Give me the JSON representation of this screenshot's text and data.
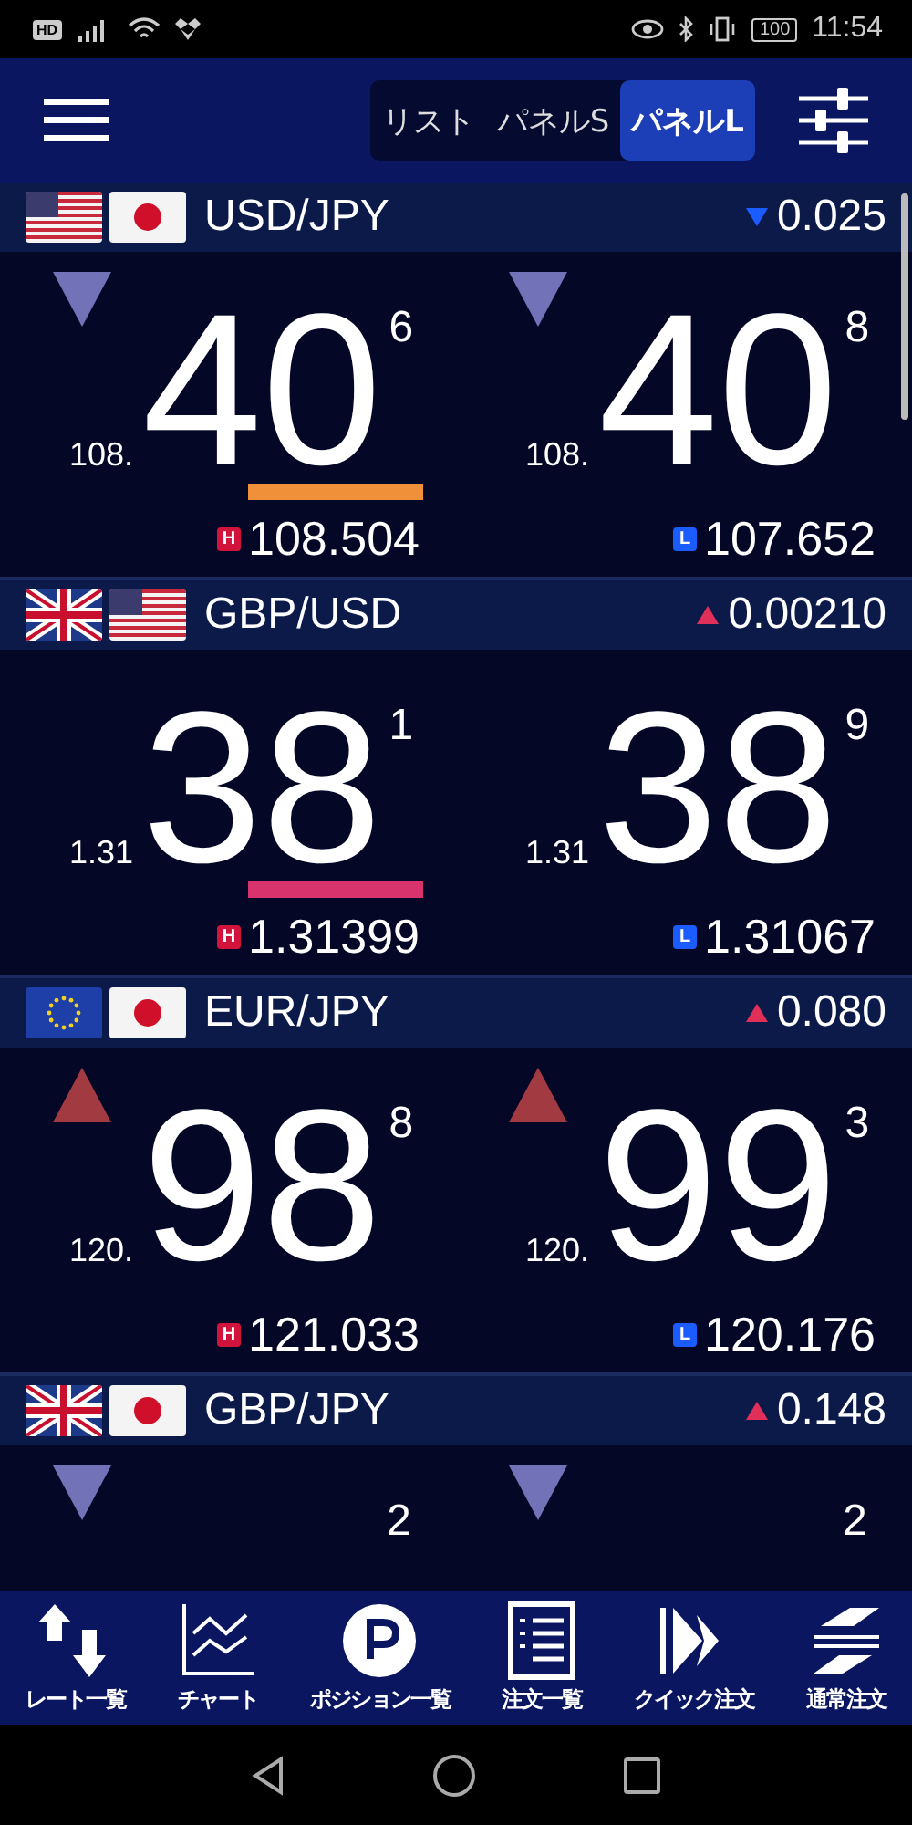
{
  "status_bar": {
    "hd": "HD",
    "battery": "100",
    "time": "11:54"
  },
  "view_tabs": [
    {
      "label": "リスト",
      "selected": false
    },
    {
      "label": "パネルS",
      "selected": false
    },
    {
      "label": "パネルL",
      "selected": true
    }
  ],
  "pairs": [
    {
      "flags": [
        {
          "kind": "us"
        },
        {
          "kind": "jp"
        }
      ],
      "name": "USD/JPY",
      "rising": false,
      "change": "0.025",
      "quotes": [
        {
          "arrow": {
            "kind": "down"
          },
          "prefix": "108.",
          "big": "40",
          "small": "6",
          "color": "#f0913a",
          "mark": "H",
          "extreme": "108.504"
        },
        {
          "arrow": {
            "kind": "down"
          },
          "prefix": "108.",
          "big": "40",
          "small": "8",
          "mark": "L",
          "extreme": "107.652"
        }
      ]
    },
    {
      "flags": [
        {
          "kind": "gb"
        },
        {
          "kind": "us"
        }
      ],
      "name": "GBP/USD",
      "rising": true,
      "change": "0.00210",
      "quotes": [
        {
          "prefix": "1.31",
          "big": "38",
          "small": "1",
          "color": "#d8336c",
          "mark": "H",
          "extreme": "1.31399"
        },
        {
          "prefix": "1.31",
          "big": "38",
          "small": "9",
          "mark": "L",
          "extreme": "1.31067"
        }
      ]
    },
    {
      "flags": [
        {
          "kind": "eu"
        },
        {
          "kind": "jp"
        }
      ],
      "name": "EUR/JPY",
      "rising": true,
      "change": "0.080",
      "quotes": [
        {
          "arrow": {
            "kind": "up"
          },
          "prefix": "120.",
          "big": "98",
          "small": "8",
          "mark": "H",
          "extreme": "121.033"
        },
        {
          "arrow": {
            "kind": "up"
          },
          "prefix": "120.",
          "big": "99",
          "small": "3",
          "mark": "L",
          "extreme": "120.176"
        }
      ]
    },
    {
      "flags": [
        {
          "kind": "gb"
        },
        {
          "kind": "jp"
        }
      ],
      "name": "GBP/JPY",
      "rising": true,
      "change": "0.148",
      "quotes": [
        {
          "arrow": {
            "kind": "down"
          },
          "small": "2"
        },
        {
          "arrow": {
            "kind": "down"
          },
          "small": "2"
        }
      ]
    }
  ],
  "bottom_nav": [
    {
      "kind": "rates",
      "label": "レート一覧"
    },
    {
      "kind": "chart",
      "label": "チャート"
    },
    {
      "kind": "positions",
      "label": "ポジション一覧"
    },
    {
      "kind": "orders",
      "label": "注文一覧"
    },
    {
      "kind": "quick",
      "label": "クイック注文"
    },
    {
      "kind": "normal",
      "label": "通常注文"
    }
  ]
}
